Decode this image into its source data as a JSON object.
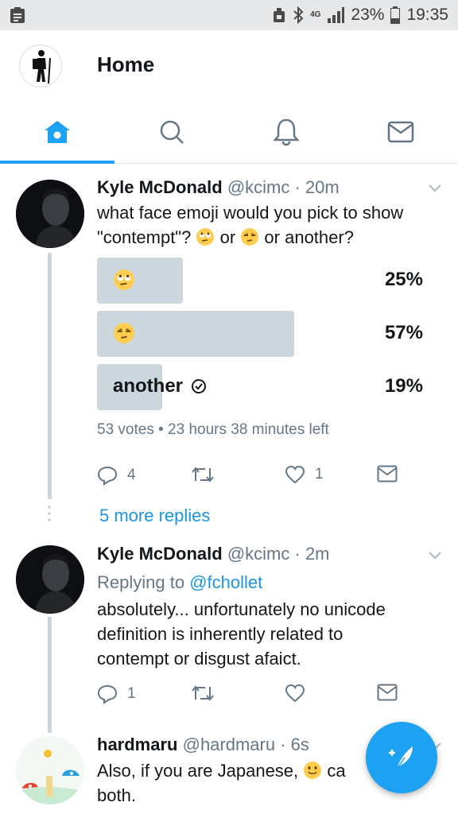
{
  "status_bar": {
    "network": "4G",
    "battery": "23%",
    "time": "19:35"
  },
  "header": {
    "title": "Home"
  },
  "tabs": [
    {
      "name": "home-icon",
      "active": true
    },
    {
      "name": "search-icon",
      "active": false
    },
    {
      "name": "bell-icon",
      "active": false
    },
    {
      "name": "mail-icon",
      "active": false
    }
  ],
  "colors": {
    "accent": "#1da1f2",
    "link": "#1b95e0",
    "muted": "#657786",
    "poll_bar": "#ccd6dd"
  },
  "tweets": [
    {
      "name": "Kyle McDonald",
      "handle": "@kcimc",
      "time": "· 20m",
      "text_line1": "what face emoji would you pick to show",
      "text_line2_a": "\"contempt\"?",
      "text_line2_b": "or",
      "text_line2_c": "or another?",
      "poll": [
        {
          "label": "",
          "emoji": "rolling-eyes-emoji",
          "percent_text": "25%",
          "percent": 25
        },
        {
          "label": "",
          "emoji": "unamused-face-emoji",
          "percent_text": "57%",
          "percent": 57
        },
        {
          "label": "another",
          "emoji": "",
          "percent_text": "19%",
          "percent": 19,
          "selected": true
        }
      ],
      "poll_meta": "53 votes • 23 hours 38 minutes left",
      "replies": "4",
      "retweets": "",
      "likes": "1"
    },
    {
      "name": "Kyle McDonald",
      "handle": "@kcimc",
      "time": "· 2m",
      "replying_prefix": "Replying to",
      "replying_to": "@fchollet",
      "text_line1": "absolutely... unfortunately no unicode",
      "text_line2": "definition is inherently related to",
      "text_line3": "contempt or disgust afaict.",
      "replies": "1",
      "retweets": "",
      "likes": ""
    },
    {
      "name": "hardmaru",
      "handle": "@hardmaru",
      "time": "· 6s",
      "text_line1_a": "Also, if you are Japanese,",
      "text_line1_b": "ca",
      "text_line2": "both."
    }
  ],
  "more_replies": "5 more replies"
}
